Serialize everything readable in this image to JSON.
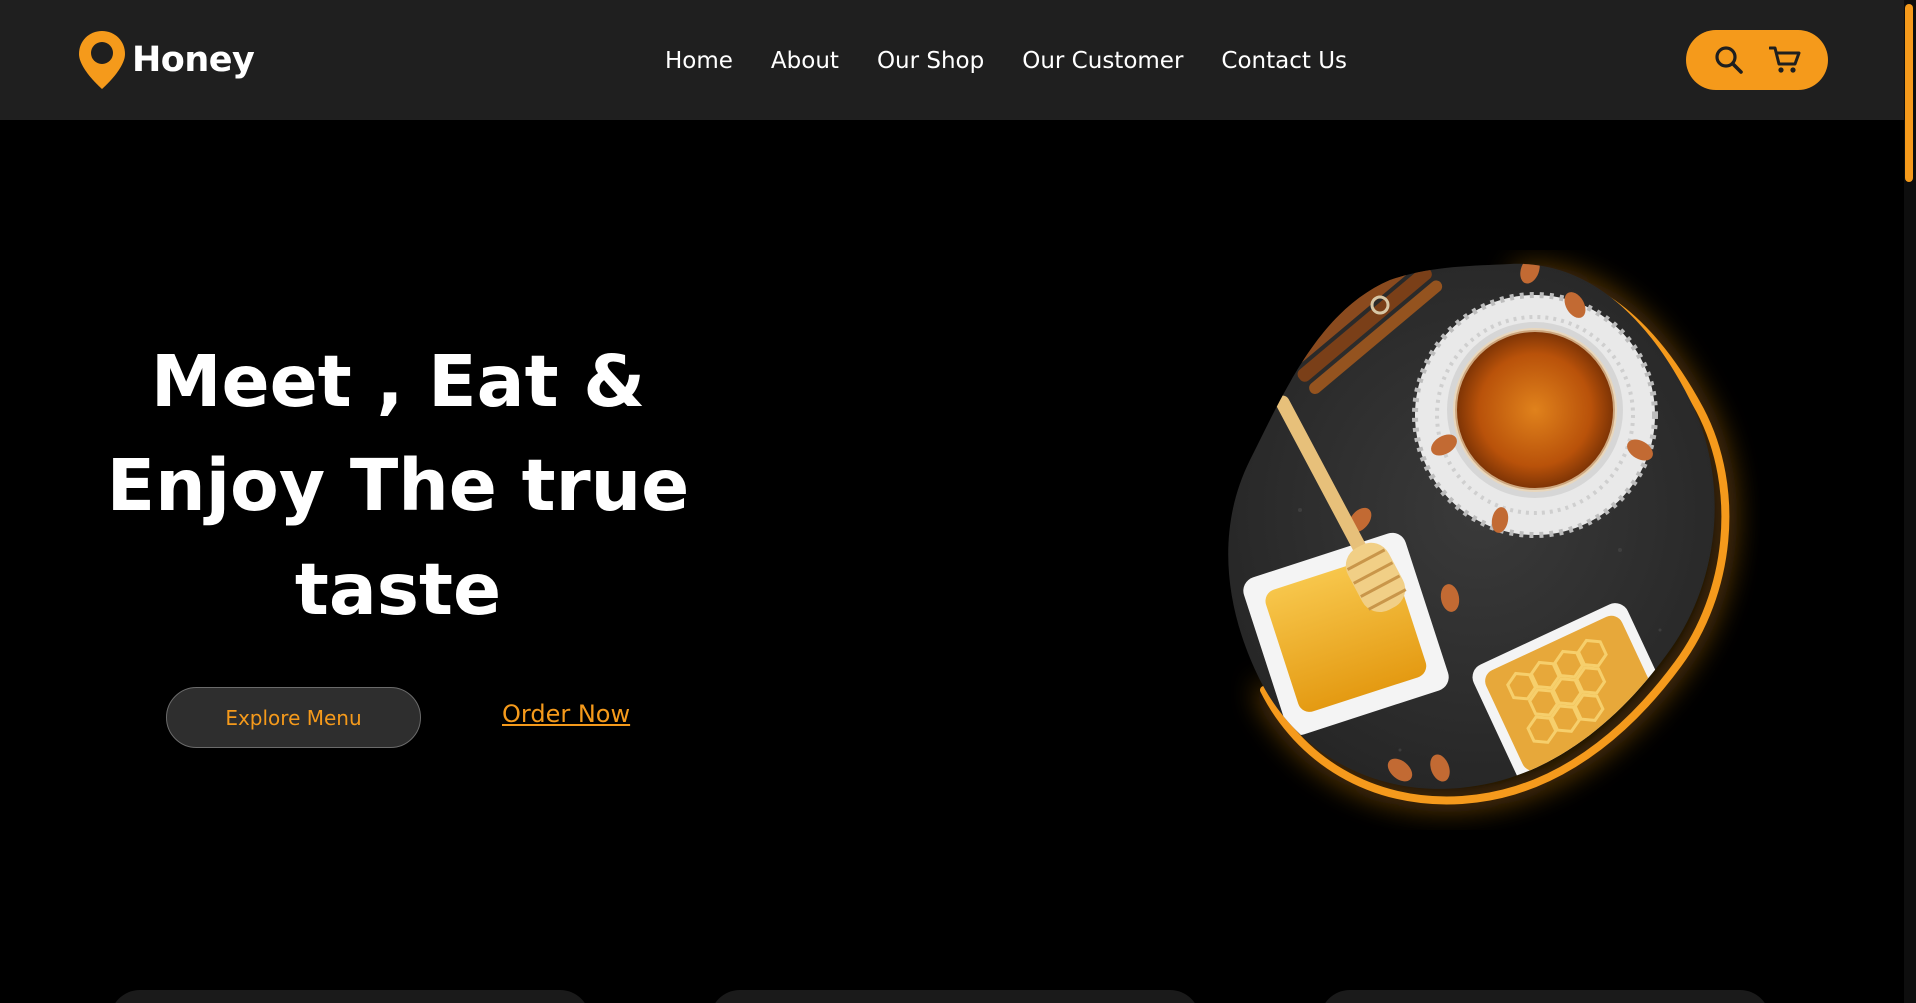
{
  "brand": {
    "name": "Honey"
  },
  "nav": {
    "items": [
      {
        "label": "Home"
      },
      {
        "label": "About"
      },
      {
        "label": "Our Shop"
      },
      {
        "label": "Our Customer"
      },
      {
        "label": "Contact Us"
      }
    ]
  },
  "header_actions": {
    "search_icon": "search-icon",
    "cart_icon": "cart-icon"
  },
  "hero": {
    "title_lines": [
      "Meet , Eat &",
      "Enjoy The true",
      "taste"
    ],
    "explore_label": "Explore Menu",
    "order_label": "Order Now"
  },
  "colors": {
    "accent": "#f59a1b",
    "header_bg": "#1f1f1f",
    "page_bg": "#000000",
    "button_bg": "#2e2e2e"
  }
}
